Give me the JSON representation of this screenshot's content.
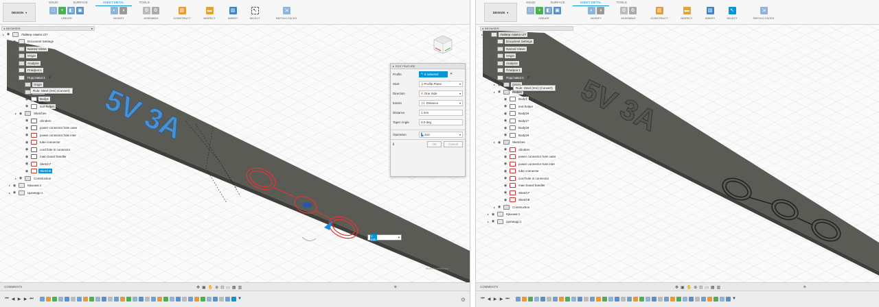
{
  "left": {
    "workspace": "DESIGN",
    "tabs": [
      "SOLID",
      "SURFACE",
      "SHEET METAL",
      "TOOLS"
    ],
    "active_tab": "SHEET METAL",
    "groups": [
      "CREATE",
      "MODIFY",
      "ASSEMBLE",
      "CONSTRUCT",
      "INSPECT",
      "INSERT",
      "SELECT",
      "REFOLD FACES"
    ],
    "browser": {
      "title": "BROWSER",
      "items": [
        {
          "label": "Лайвер-лампа v27",
          "type": "doc"
        },
        {
          "label": "Document Settings",
          "type": "gear"
        },
        {
          "label": "Named Views",
          "type": "folder"
        },
        {
          "label": "Origin",
          "type": "folder"
        },
        {
          "label": "Analysis",
          "type": "folder"
        },
        {
          "label": "Плафон:1",
          "type": "comp"
        },
        {
          "label": "Подставка:1",
          "type": "comp",
          "state": "highlighted"
        },
        {
          "label": "Origin",
          "type": "folder"
        },
        {
          "label": "Bodies",
          "type": "folder"
        },
        {
          "label": "Body1",
          "type": "body"
        },
        {
          "label": "text-helper",
          "type": "body"
        },
        {
          "label": "Sketches",
          "type": "folder"
        },
        {
          "label": "cilinders",
          "type": "sketch"
        },
        {
          "label": "power connector hole outer",
          "type": "sketch"
        },
        {
          "label": "power connector hole inter",
          "type": "sketch"
        },
        {
          "label": "tube connector",
          "type": "sketch"
        },
        {
          "label": "cord hole in connector",
          "type": "sketch"
        },
        {
          "label": "main board handler",
          "type": "sketch"
        },
        {
          "label": "Sketch7",
          "type": "sketch"
        },
        {
          "label": "Sketch8",
          "type": "sketch",
          "state": "selected"
        },
        {
          "label": "Construction",
          "type": "folder"
        },
        {
          "label": "Крышка:1",
          "type": "comp"
        },
        {
          "label": "Цилиндр:1",
          "type": "comp"
        }
      ],
      "rule_tooltip": "Rule: Steel (mm) (Convert)"
    },
    "edit_feature": {
      "title": "EDIT FEATURE",
      "rows": [
        {
          "key": "Profile",
          "value": "5 selected"
        },
        {
          "key": "Start",
          "value": "Profile Plane"
        },
        {
          "key": "Direction",
          "value": "One Side"
        },
        {
          "key": "Extent",
          "value": "Distance"
        },
        {
          "key": "Distance",
          "value": "1 mm"
        },
        {
          "key": "Taper Angle",
          "value": "0.0 deg"
        },
        {
          "key": "Operation",
          "value": "Join"
        }
      ],
      "ok": "OK",
      "cancel": "Cancel"
    },
    "dimension_value": "1 mm",
    "model_text": "5V 3A",
    "comments": "COMMENTS",
    "watermark": "Multiple selections"
  },
  "right": {
    "workspace": "DESIGN",
    "tabs": [
      "SOLID",
      "SURFACE",
      "SHEET METAL",
      "TOOLS"
    ],
    "active_tab": "SHEET METAL",
    "groups": [
      "CREATE",
      "MODIFY",
      "ASSEMBLE",
      "CONSTRUCT",
      "INSPECT",
      "INSERT",
      "SELECT",
      "REFOLD FACES"
    ],
    "browser": {
      "title": "BROWSER",
      "items": [
        {
          "label": "Лайвер-лампа v27",
          "type": "doc"
        },
        {
          "label": "Document Settings",
          "type": "gear"
        },
        {
          "label": "Named Views",
          "type": "folder"
        },
        {
          "label": "Origin",
          "type": "folder"
        },
        {
          "label": "Analysis",
          "type": "folder"
        },
        {
          "label": "Плафон:1",
          "type": "comp"
        },
        {
          "label": "Подставка:1",
          "type": "comp",
          "state": "highlighted"
        },
        {
          "label": "Origin",
          "type": "folder"
        },
        {
          "label": "Bodies",
          "type": "folder"
        },
        {
          "label": "Body1",
          "type": "body"
        },
        {
          "label": "text-helper",
          "type": "body"
        },
        {
          "label": "Body16",
          "type": "body"
        },
        {
          "label": "Body17",
          "type": "body"
        },
        {
          "label": "Body18",
          "type": "body"
        },
        {
          "label": "Body19",
          "type": "body"
        },
        {
          "label": "Sketches",
          "type": "folder"
        },
        {
          "label": "cilinders",
          "type": "sketch"
        },
        {
          "label": "power connector hole outer",
          "type": "sketch"
        },
        {
          "label": "power connector hole inter",
          "type": "sketch"
        },
        {
          "label": "tube connector",
          "type": "sketch"
        },
        {
          "label": "cord hole in connector",
          "type": "sketch"
        },
        {
          "label": "main board handler",
          "type": "sketch"
        },
        {
          "label": "Sketch7",
          "type": "sketch"
        },
        {
          "label": "Sketch8",
          "type": "sketch"
        },
        {
          "label": "Construction",
          "type": "folder"
        },
        {
          "label": "Крышка:1",
          "type": "comp"
        },
        {
          "label": "Цилиндр:1",
          "type": "comp"
        }
      ],
      "rule_tooltip": "Rule: Steel (mm) (Convert)"
    },
    "model_text": "5V 3A",
    "comments": "COMMENTS"
  },
  "colors": {
    "accent": "#0696d7",
    "plate": "#5b5b55",
    "sketch_red": "#e03535"
  }
}
